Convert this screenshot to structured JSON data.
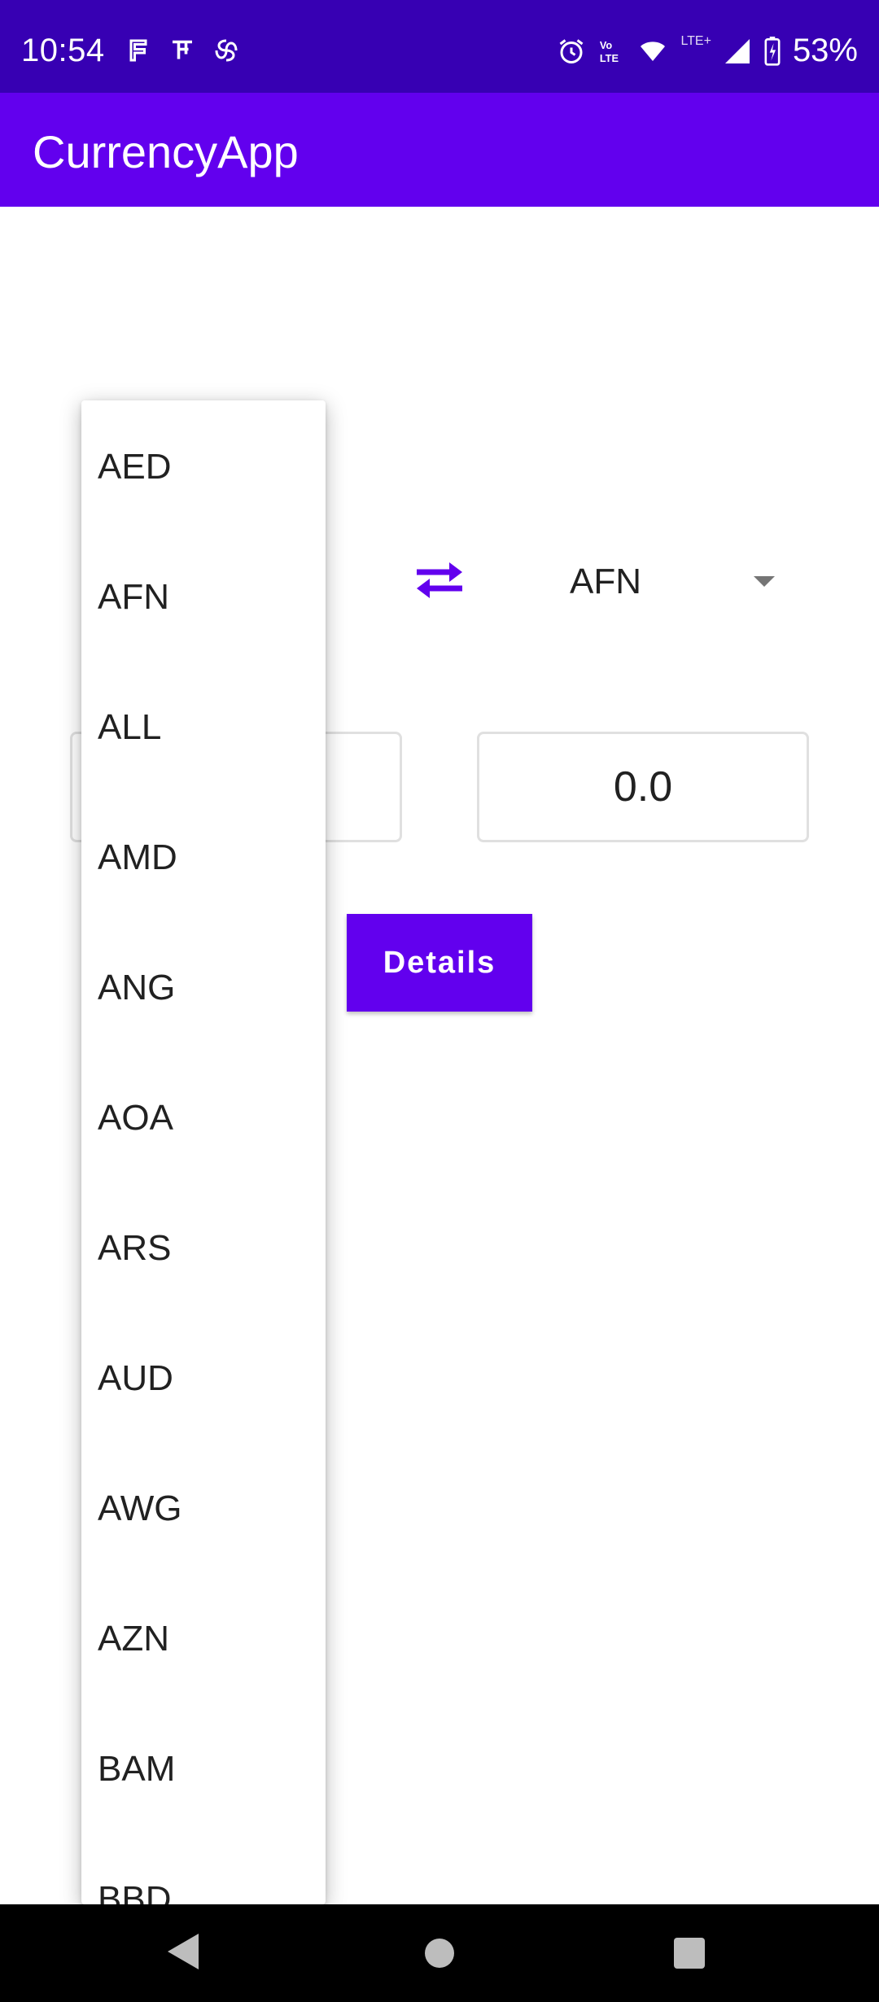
{
  "status_bar": {
    "time": "10:54",
    "battery": "53%",
    "left_icons": [
      "notification-icon-1",
      "notification-icon-2",
      "notification-icon-3"
    ],
    "right_icons": [
      "alarm-icon",
      "volte-icon",
      "wifi-icon",
      "signal-icon",
      "battery-icon"
    ],
    "signal_label": "LTE+"
  },
  "app_bar": {
    "title": "CurrencyApp"
  },
  "converter": {
    "to_currency": "AFN",
    "to_value": "0.0",
    "details_label": "Details"
  },
  "dropdown": {
    "items": [
      "AED",
      "AFN",
      "ALL",
      "AMD",
      "ANG",
      "AOA",
      "ARS",
      "AUD",
      "AWG",
      "AZN",
      "BAM",
      "BBD"
    ]
  },
  "colors": {
    "primary": "#6200ee",
    "primary_dark": "#3700b3"
  }
}
